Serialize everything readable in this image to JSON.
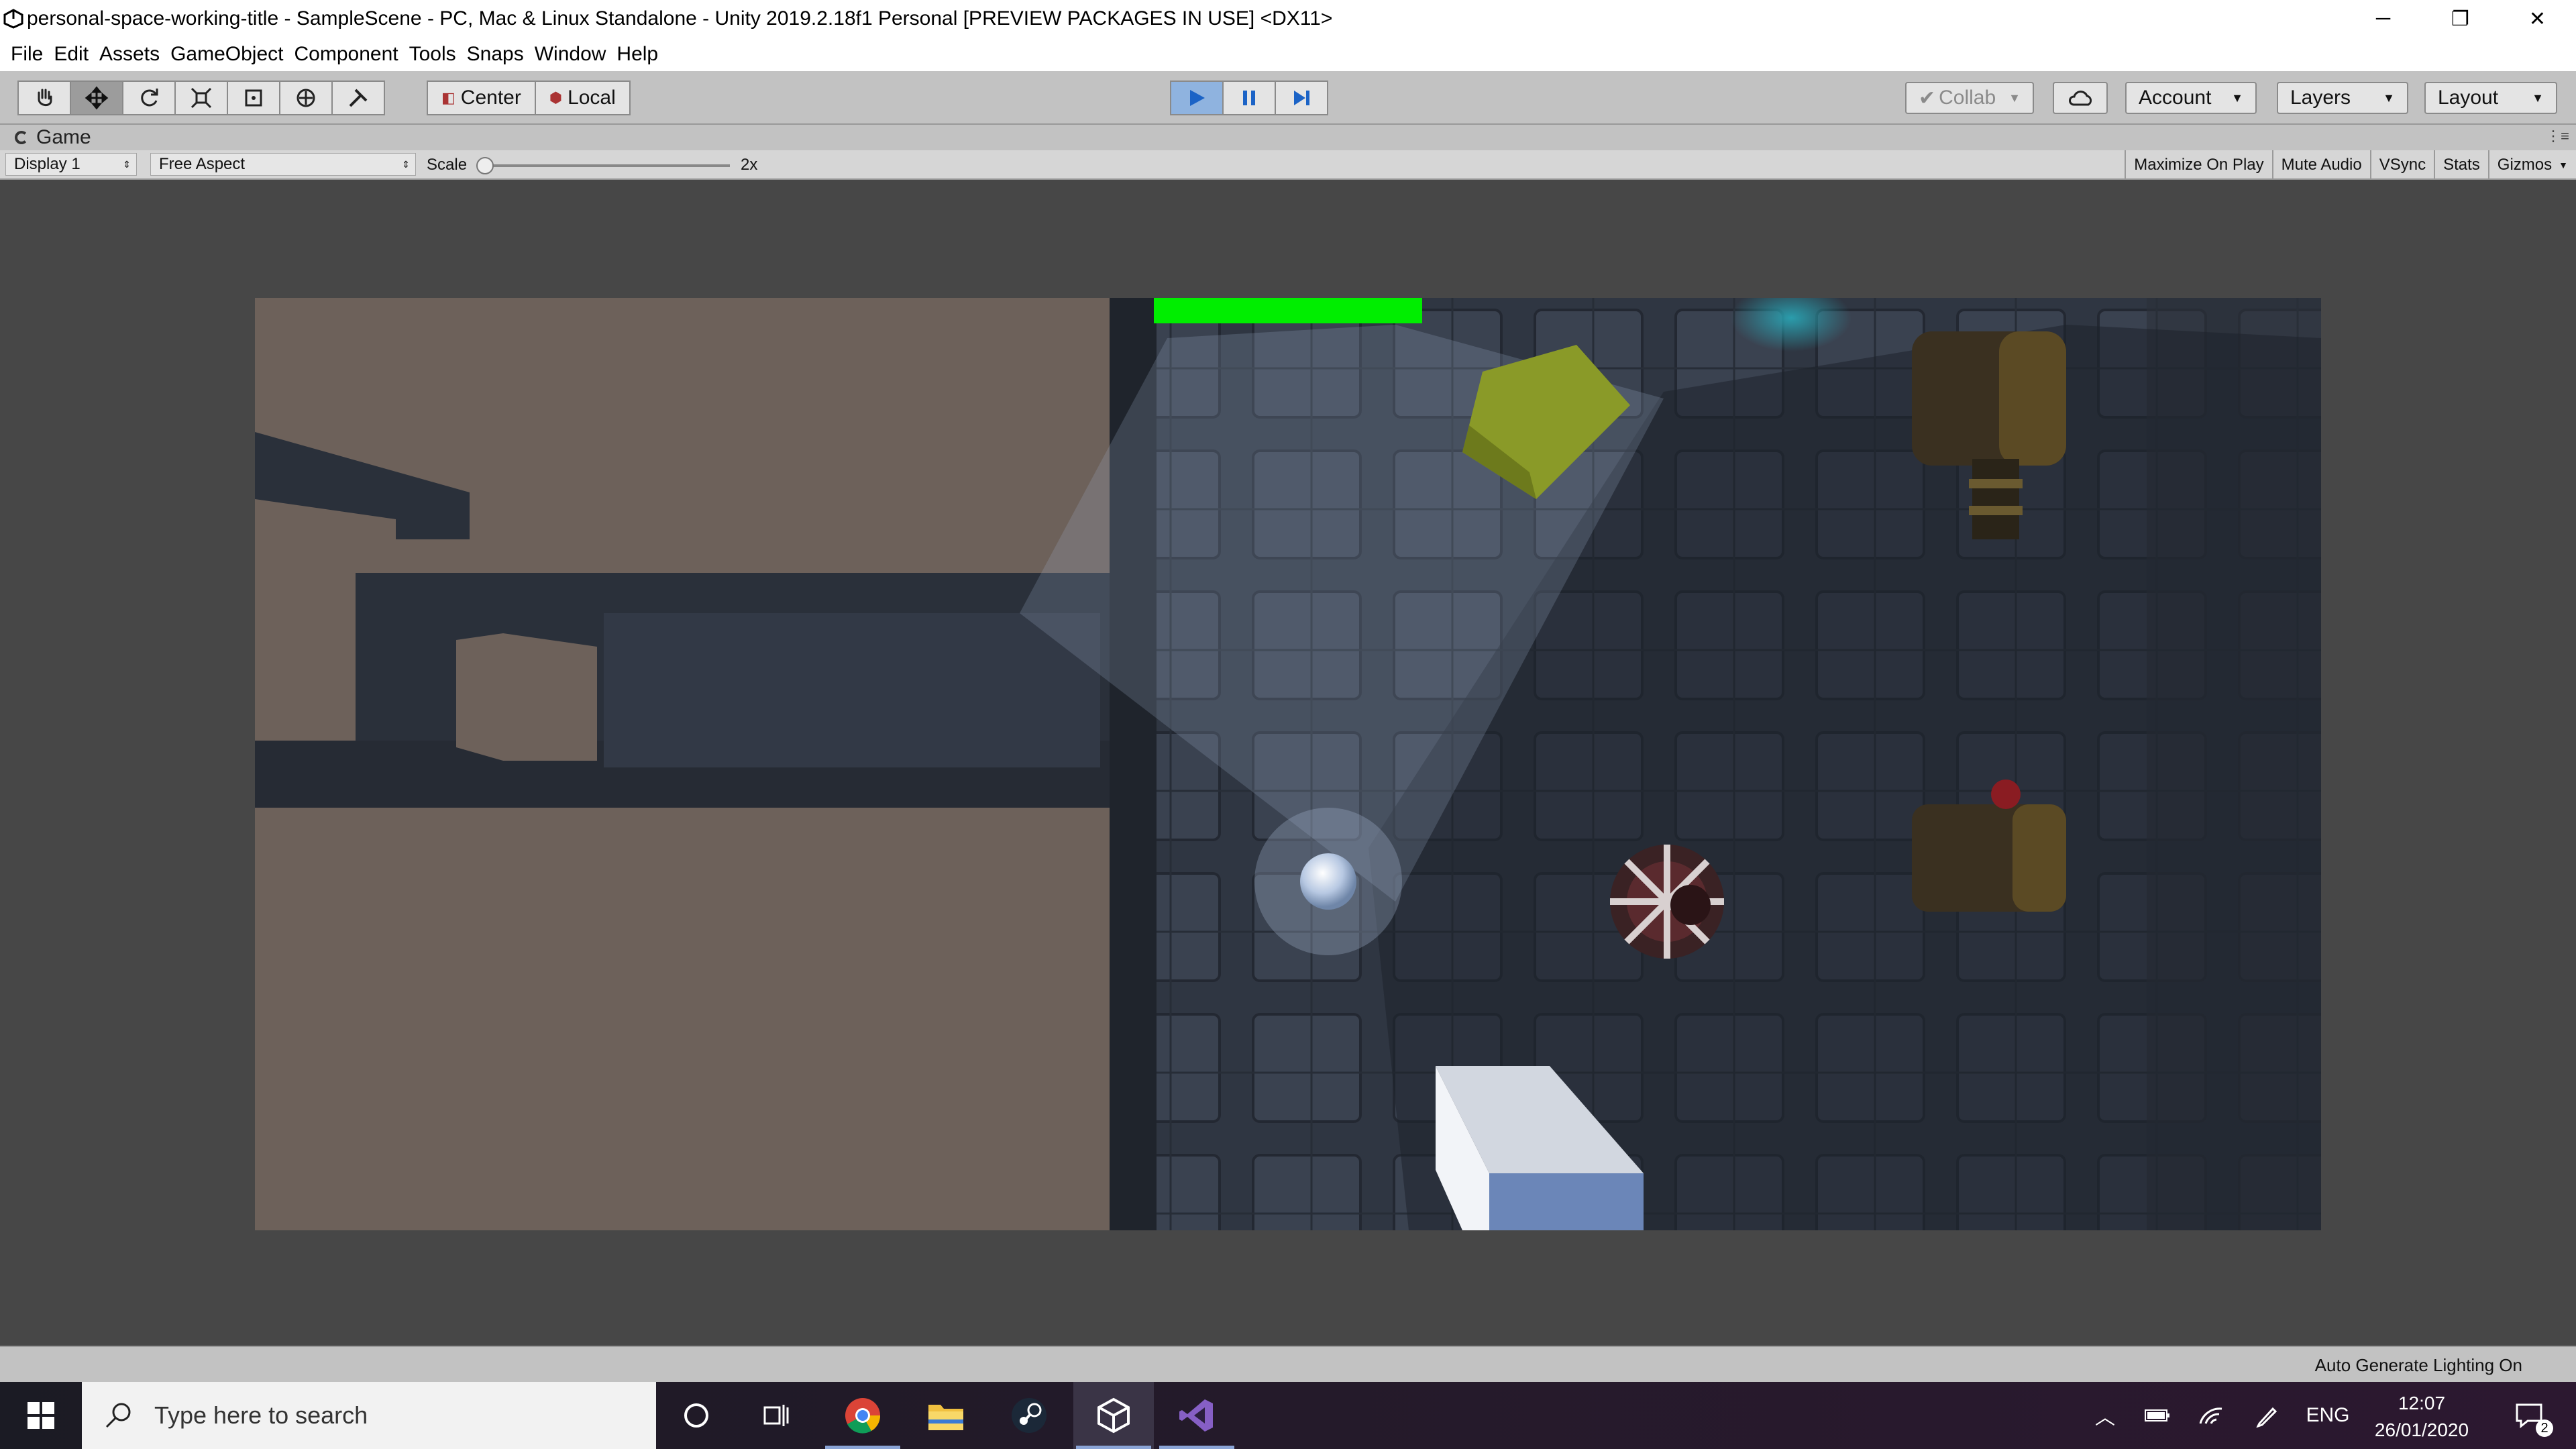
{
  "window": {
    "title": "personal-space-working-title - SampleScene - PC, Mac & Linux Standalone - Unity 2019.2.18f1 Personal [PREVIEW PACKAGES IN USE] <DX11>",
    "minimize": "─",
    "restore": "❐",
    "close": "✕"
  },
  "menu": [
    "File",
    "Edit",
    "Assets",
    "GameObject",
    "Component",
    "Tools",
    "Snaps",
    "Window",
    "Help"
  ],
  "toolbar": {
    "pivot_label": "Center",
    "space_label": "Local",
    "collab_label": "Collab",
    "account_label": "Account",
    "layers_label": "Layers",
    "layout_label": "Layout"
  },
  "game_view": {
    "tab_label": "Game",
    "display_label": "Display 1",
    "aspect_label": "Free Aspect",
    "scale_label": "Scale",
    "scale_value": "2x",
    "scale_fraction": 0.0,
    "toggles": [
      "Maximize On Play",
      "Mute Audio",
      "VSync",
      "Stats",
      "Gizmos"
    ]
  },
  "status": {
    "text": "Auto Generate Lighting On"
  },
  "taskbar": {
    "search_placeholder": "Type here to search",
    "language": "ENG",
    "time": "12:07",
    "date": "26/01/2020",
    "notification_count": "2"
  },
  "colors": {
    "health_bar": "#00ee00",
    "play_active": "#8fb3df",
    "floor_left": "#6d615a",
    "floor_right": "#2e3440"
  },
  "game_state": {
    "health_fraction": 1.0
  }
}
